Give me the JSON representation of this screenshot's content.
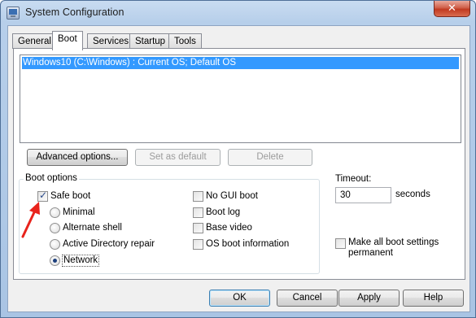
{
  "window": {
    "title": "System Configuration",
    "app_icon": "system-config-icon",
    "close_glyph": "✕"
  },
  "tabs": [
    {
      "label": "General",
      "active": false
    },
    {
      "label": "Boot",
      "active": true
    },
    {
      "label": "Services",
      "active": false
    },
    {
      "label": "Startup",
      "active": false
    },
    {
      "label": "Tools",
      "active": false
    }
  ],
  "boot_list": {
    "items": [
      {
        "label": "Windows10 (C:\\Windows) : Current OS; Default OS",
        "selected": true
      }
    ]
  },
  "list_buttons": {
    "advanced": "Advanced options...",
    "set_default": "Set as default",
    "delete": "Delete"
  },
  "boot_options": {
    "group_label": "Boot options",
    "safe_boot": {
      "label": "Safe boot",
      "checked": true
    },
    "minimal": {
      "label": "Minimal",
      "selected": false
    },
    "alternate_shell": {
      "label": "Alternate shell",
      "selected": false
    },
    "active_directory": {
      "label": "Active Directory repair",
      "selected": false
    },
    "network": {
      "label": "Network",
      "selected": true
    },
    "no_gui": {
      "label": "No GUI boot",
      "checked": false
    },
    "boot_log": {
      "label": "Boot log",
      "checked": false
    },
    "base_video": {
      "label": "Base video",
      "checked": false
    },
    "os_boot_info": {
      "label": "OS boot information",
      "checked": false
    }
  },
  "timeout": {
    "label": "Timeout:",
    "value": "30",
    "unit": "seconds"
  },
  "make_permanent": {
    "line1": "Make all boot settings",
    "line2": "permanent",
    "checked": false
  },
  "footer": {
    "ok": "OK",
    "cancel": "Cancel",
    "apply": "Apply",
    "help": "Help"
  },
  "colors": {
    "selection": "#3399ff",
    "annotation_arrow": "#e8231c"
  }
}
